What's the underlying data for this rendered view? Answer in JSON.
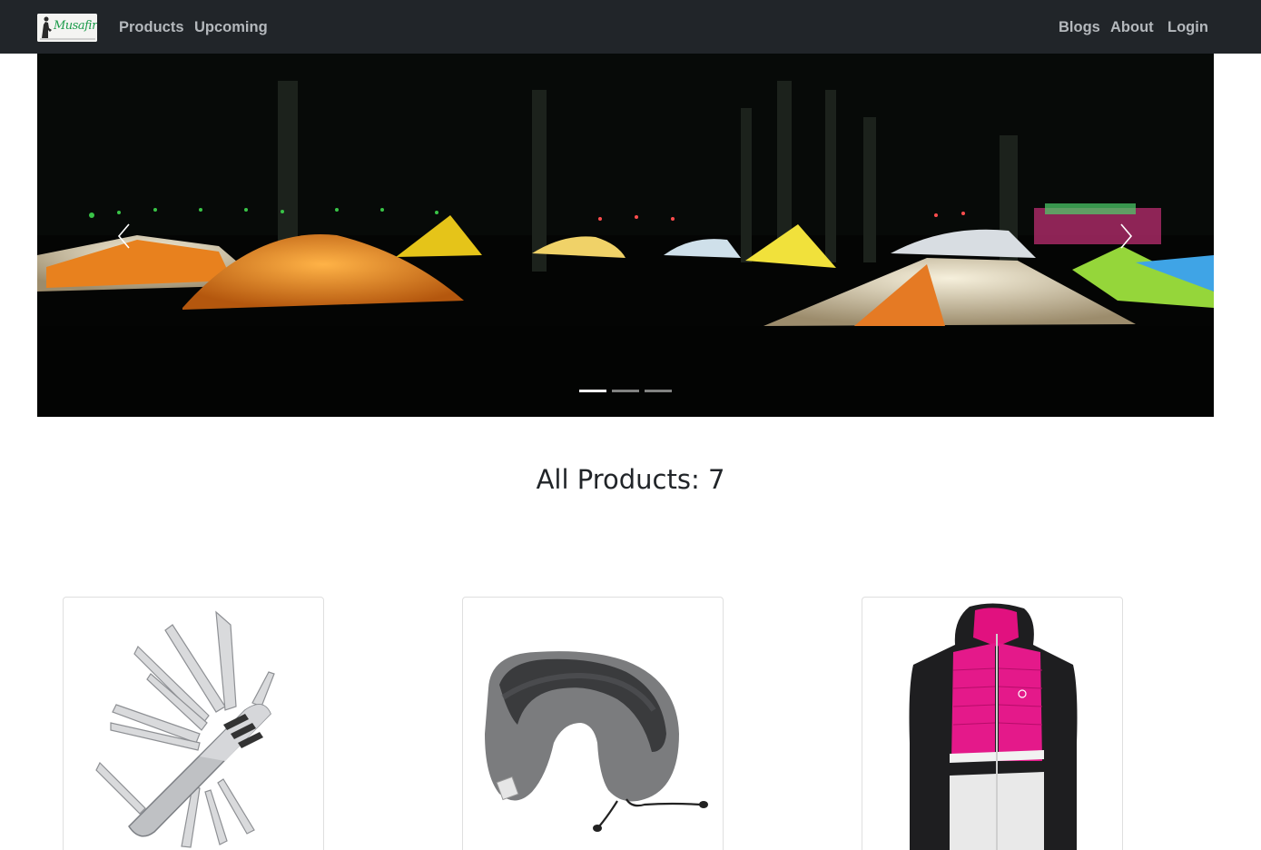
{
  "navbar": {
    "brand": "Musafir",
    "left_links": [
      "Products",
      "Upcoming"
    ],
    "right_links": [
      "Blogs",
      "About",
      "Login"
    ]
  },
  "carousel": {
    "prev_icon": "chevron-left-icon",
    "next_icon": "chevron-right-icon",
    "slide_count": 3,
    "active_slide": 1
  },
  "products": {
    "heading_label": "All Products:",
    "count": "7",
    "items": [
      {
        "image": "multi-tool-knife"
      },
      {
        "image": "neck-pillow"
      },
      {
        "image": "pink-jacket"
      }
    ]
  },
  "colors": {
    "navbar_bg": "#212529",
    "nav_link": "#b4b8bc",
    "heading": "#212529"
  }
}
